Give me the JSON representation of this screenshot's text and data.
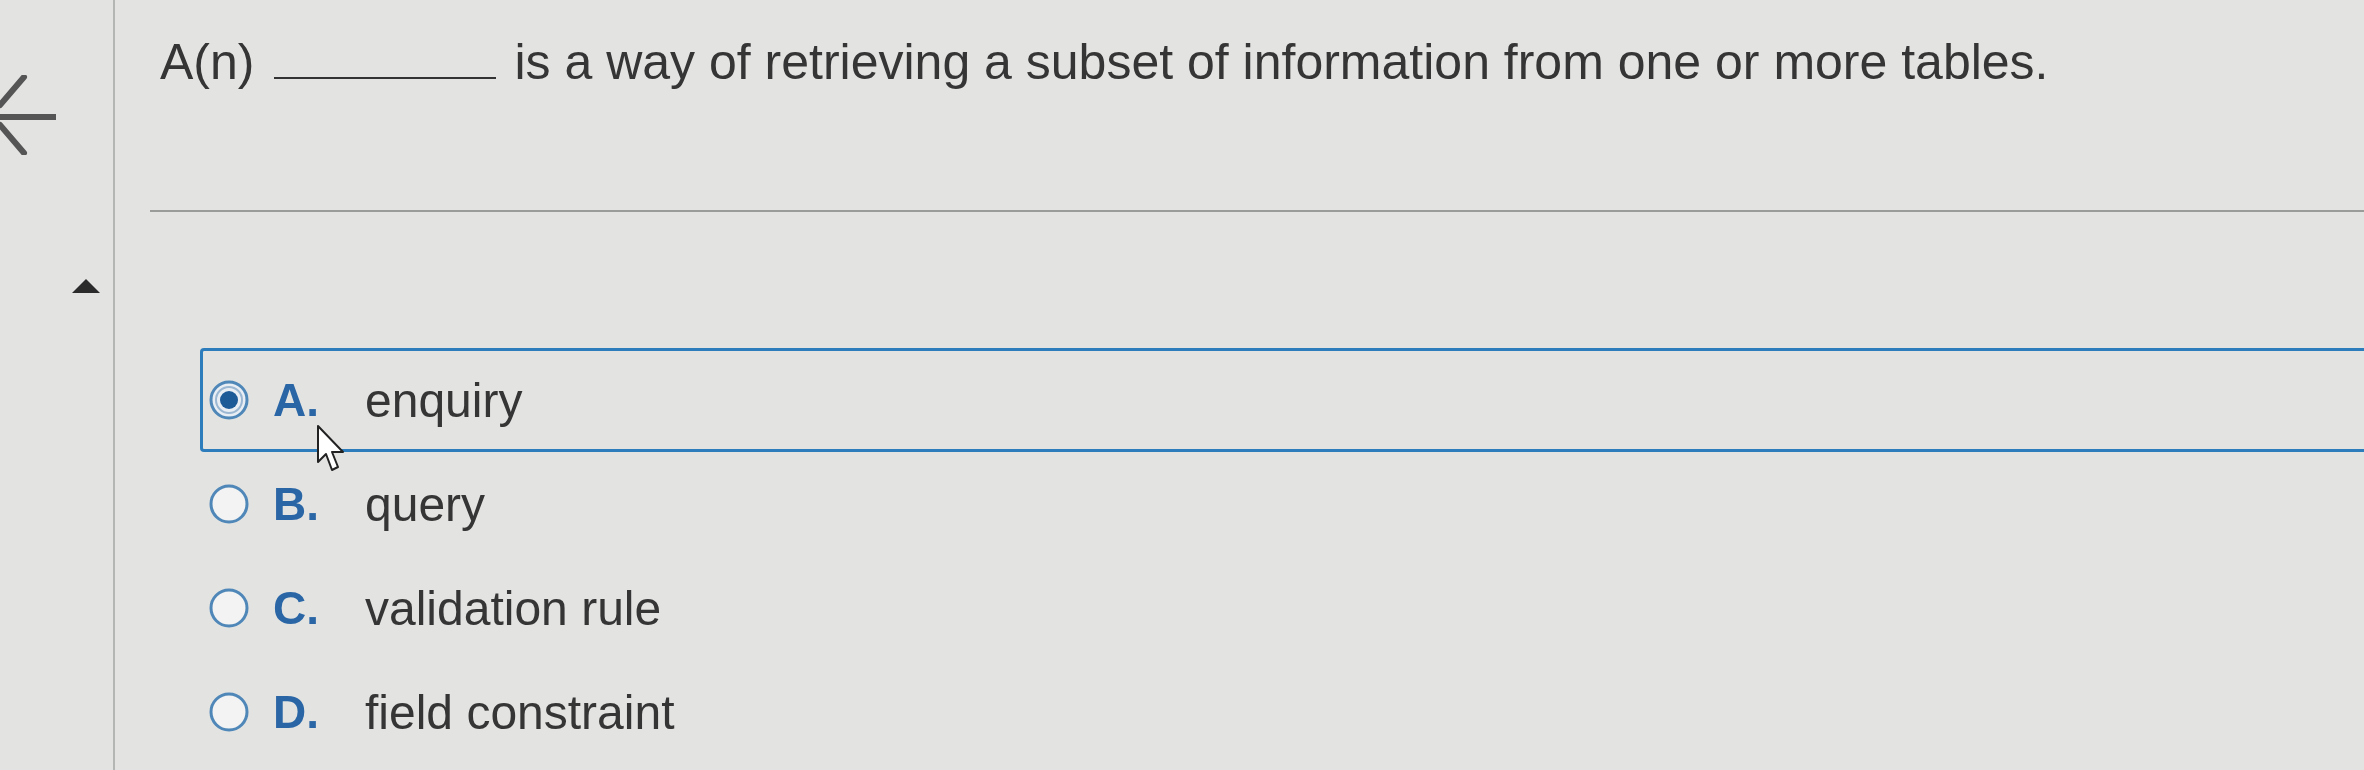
{
  "question": {
    "prefix": "A(n)",
    "text": "is a way of retrieving a subset of information from one or more tables."
  },
  "options": [
    {
      "letter": "A.",
      "text": "enquiry",
      "selected": true
    },
    {
      "letter": "B.",
      "text": "query",
      "selected": false
    },
    {
      "letter": "C.",
      "text": "validation rule",
      "selected": false
    },
    {
      "letter": "D.",
      "text": "field constraint",
      "selected": false
    }
  ]
}
